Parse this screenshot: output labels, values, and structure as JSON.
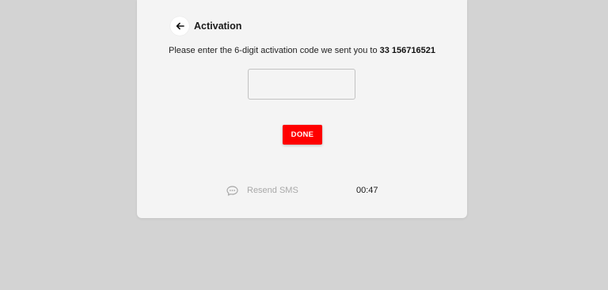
{
  "header": {
    "title": "Activation",
    "back_icon": "arrow-left-icon"
  },
  "instruction": {
    "text": "Please enter the 6-digit activation code we sent you to ",
    "phone": "33 156716521"
  },
  "code_input": {
    "value": "",
    "placeholder": ""
  },
  "actions": {
    "done_label": "DONE"
  },
  "resend": {
    "label": "Resend SMS",
    "icon": "chat-bubble-icon",
    "timer": "00:47"
  },
  "colors": {
    "accent": "#ff0000",
    "background": "#d3d3d3",
    "card": "#f4f4f4",
    "disabled_text": "#a9a9a9"
  }
}
